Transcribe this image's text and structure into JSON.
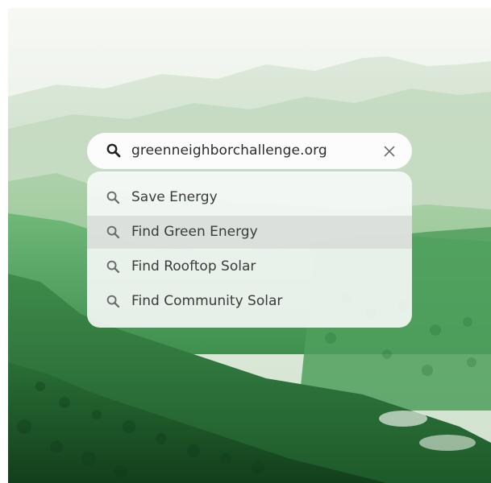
{
  "search": {
    "query": "greenneighborchallenge.org",
    "lead_icon": "search-icon",
    "clear_icon": "close-icon"
  },
  "suggestions": [
    {
      "label": "Save Energy",
      "icon": "search-icon",
      "highlighted": false
    },
    {
      "label": "Find Green Energy",
      "icon": "search-icon",
      "highlighted": true
    },
    {
      "label": "Find Rooftop Solar",
      "icon": "search-icon",
      "highlighted": false
    },
    {
      "label": "Find Community Solar",
      "icon": "search-icon",
      "highlighted": false
    }
  ],
  "colors": {
    "sky": "#eef3ec",
    "mountain_far": "#d6e4d3",
    "forest_mid": "#5aa86a",
    "forest_dark": "#1f5a2c",
    "highlight_row": "#d7dcd9"
  }
}
